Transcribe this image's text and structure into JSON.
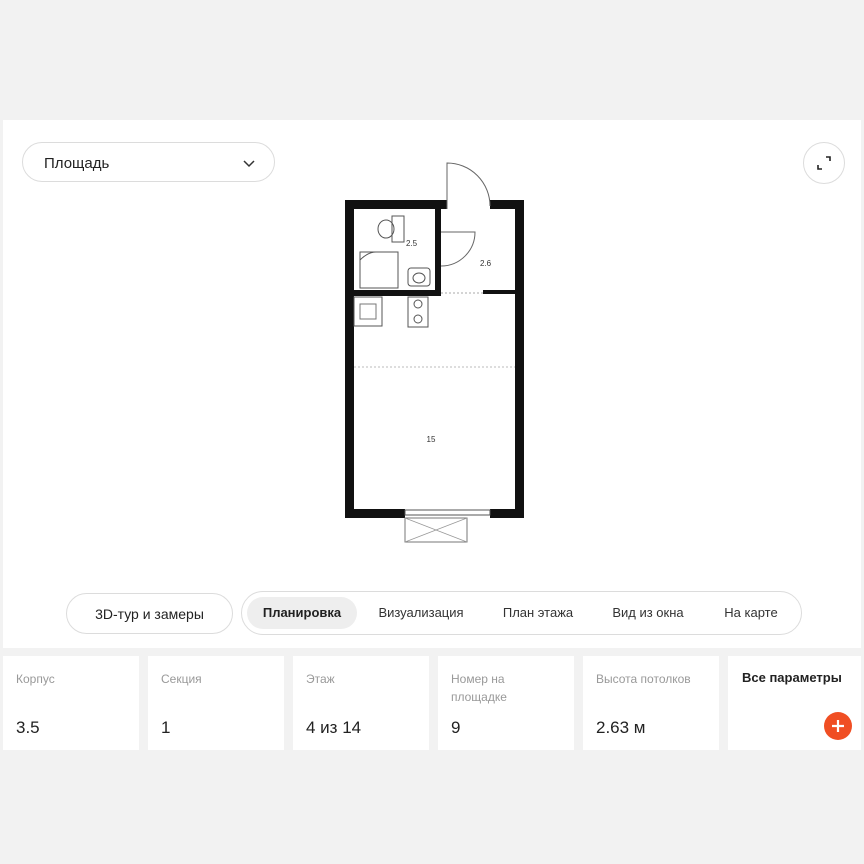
{
  "filter": {
    "label": "Площадь"
  },
  "plan": {
    "rooms": [
      {
        "name": "bathroom-area",
        "value": "2.5"
      },
      {
        "name": "hall-area",
        "value": "2.6"
      },
      {
        "name": "living-area",
        "value": "15"
      }
    ]
  },
  "tour_button": {
    "label": "3D-тур и замеры"
  },
  "tabs": [
    {
      "label": "Планировка",
      "active": true
    },
    {
      "label": "Визуализация",
      "active": false
    },
    {
      "label": "План этажа",
      "active": false
    },
    {
      "label": "Вид из окна",
      "active": false
    },
    {
      "label": "На карте",
      "active": false
    }
  ],
  "params": [
    {
      "label": "Корпус",
      "value": "3.5"
    },
    {
      "label": "Секция",
      "value": "1"
    },
    {
      "label": "Этаж",
      "value": "4 из 14"
    },
    {
      "label": "Номер на площадке",
      "value": "9"
    },
    {
      "label": "Высота потолков",
      "value": "2.63 м"
    }
  ],
  "all_params": {
    "label": "Все параметры"
  },
  "colors": {
    "accent": "#f04e23",
    "wall": "#111111"
  },
  "icons": {
    "select": "chevron-down-icon",
    "expand": "expand-icon",
    "add": "plus-icon"
  }
}
